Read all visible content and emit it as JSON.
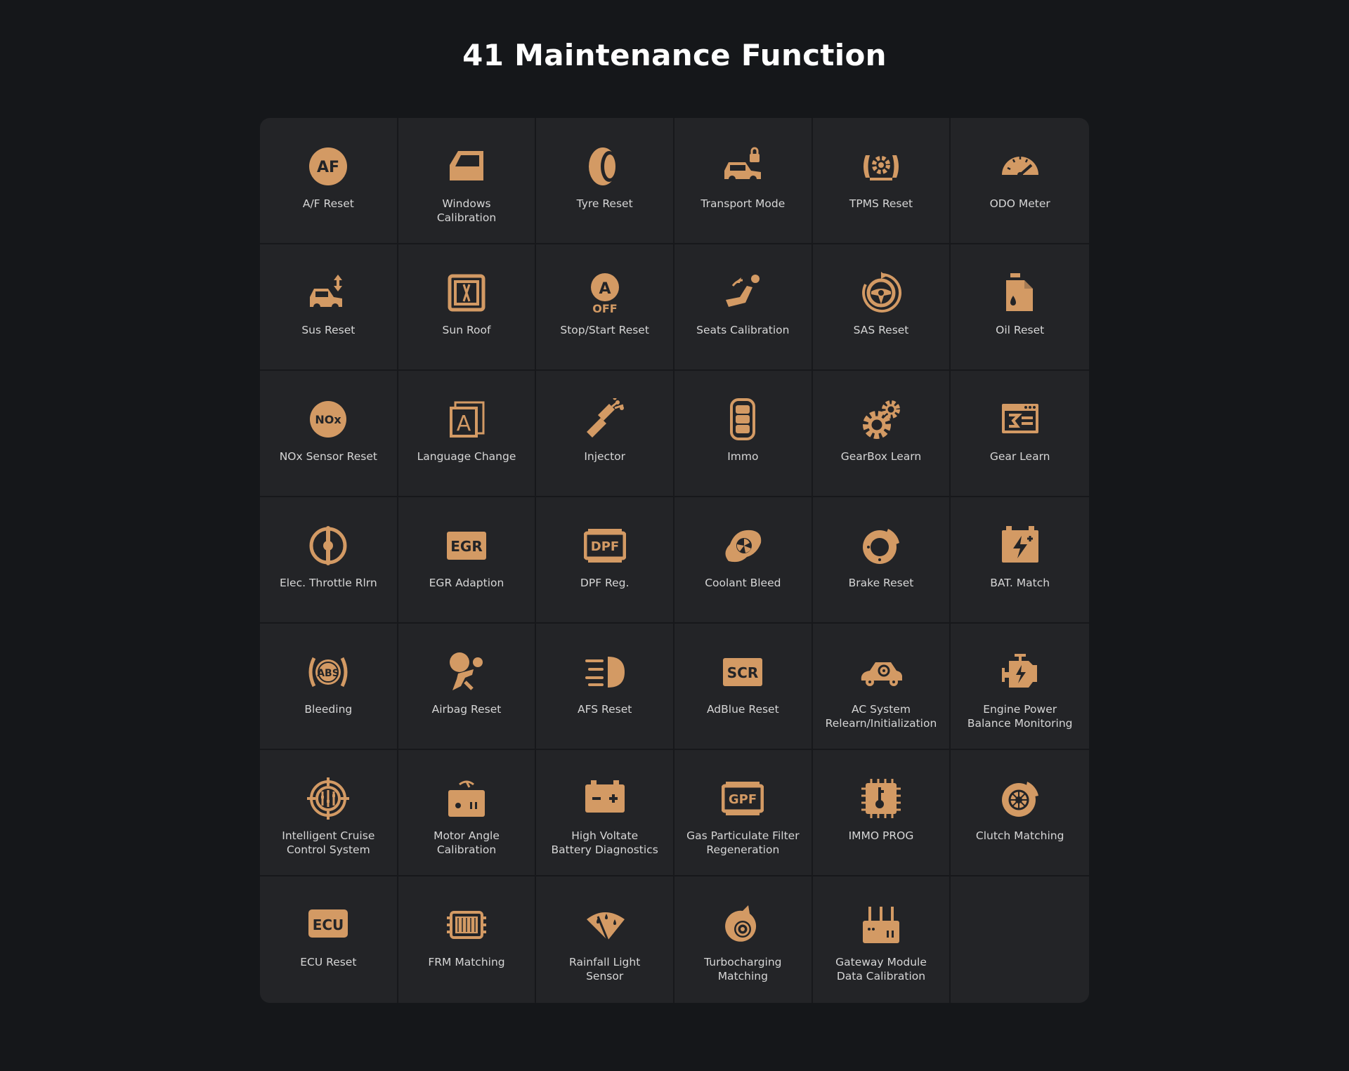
{
  "title": "41 Maintenance Function",
  "accent_color": "#d39a64",
  "items": [
    {
      "label": "A/F Reset",
      "icon": "af-reset-icon"
    },
    {
      "label": "Windows\nCalibration",
      "icon": "window-icon"
    },
    {
      "label": "Tyre Reset",
      "icon": "tyre-icon"
    },
    {
      "label": "Transport Mode",
      "icon": "car-lock-icon"
    },
    {
      "label": "TPMS Reset",
      "icon": "tpms-icon"
    },
    {
      "label": "ODO Meter",
      "icon": "speedometer-icon"
    },
    {
      "label": "Sus Reset",
      "icon": "suspension-icon"
    },
    {
      "label": "Sun Roof",
      "icon": "sunroof-icon"
    },
    {
      "label": "Stop/Start Reset",
      "icon": "auto-stop-off-icon",
      "icon_text": [
        "A",
        "OFF"
      ]
    },
    {
      "label": "Seats Calibration",
      "icon": "seat-icon"
    },
    {
      "label": "SAS Reset",
      "icon": "steering-icon"
    },
    {
      "label": "Oil Reset",
      "icon": "oil-can-icon"
    },
    {
      "label": "NOx Sensor Reset",
      "icon": "nox-icon",
      "icon_text": [
        "NOx"
      ]
    },
    {
      "label": "Language Change",
      "icon": "language-icon",
      "icon_text": [
        "A"
      ]
    },
    {
      "label": "Injector",
      "icon": "injector-icon"
    },
    {
      "label": "Immo",
      "icon": "key-fob-icon"
    },
    {
      "label": "GearBox Learn",
      "icon": "gears-icon"
    },
    {
      "label": "Gear Learn",
      "icon": "gear-panel-icon"
    },
    {
      "label": "Elec. Throttle Rlrn",
      "icon": "throttle-icon"
    },
    {
      "label": "EGR Adaption",
      "icon": "egr-icon",
      "icon_text": [
        "EGR"
      ]
    },
    {
      "label": "DPF Reg.",
      "icon": "dpf-icon",
      "icon_text": [
        "DPF"
      ]
    },
    {
      "label": "Coolant Bleed",
      "icon": "coolant-fan-icon"
    },
    {
      "label": "Brake Reset",
      "icon": "brake-disc-icon"
    },
    {
      "label": "BAT. Match",
      "icon": "battery-icon"
    },
    {
      "label": "Bleeding",
      "icon": "abs-icon",
      "icon_text": [
        "ABS"
      ]
    },
    {
      "label": "Airbag Reset",
      "icon": "airbag-icon"
    },
    {
      "label": "AFS Reset",
      "icon": "headlight-icon"
    },
    {
      "label": "AdBlue Reset",
      "icon": "scr-icon",
      "icon_text": [
        "SCR"
      ]
    },
    {
      "label": "AC System\nRelearn/Initialization",
      "icon": "ac-car-icon"
    },
    {
      "label": "Engine Power\nBalance Monitoring",
      "icon": "engine-icon"
    },
    {
      "label": "Intelligent Cruise\nControl System",
      "icon": "cruise-control-icon"
    },
    {
      "label": "Motor Angle\nCalibration",
      "icon": "motor-angle-icon"
    },
    {
      "label": "High Voltate\nBattery Diagnostics",
      "icon": "hv-battery-icon"
    },
    {
      "label": "Gas Particulate Filter\nRegeneration",
      "icon": "gpf-icon",
      "icon_text": [
        "GPF"
      ]
    },
    {
      "label": "IMMO PROG",
      "icon": "chip-icon"
    },
    {
      "label": "Clutch Matching",
      "icon": "clutch-icon"
    },
    {
      "label": "ECU Reset",
      "icon": "ecu-icon",
      "icon_text": [
        "ECU"
      ]
    },
    {
      "label": "FRM Matching",
      "icon": "frm-module-icon"
    },
    {
      "label": "Rainfall Light\nSensor",
      "icon": "rain-sensor-icon"
    },
    {
      "label": "Turbocharging\nMatching",
      "icon": "turbo-icon"
    },
    {
      "label": "Gateway Module\nData Calibration",
      "icon": "gateway-router-icon"
    }
  ]
}
